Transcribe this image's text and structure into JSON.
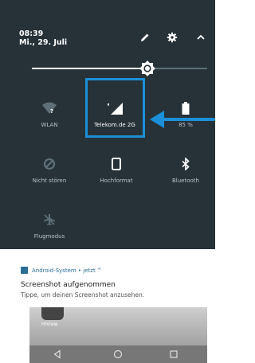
{
  "status": {
    "time": "08:39",
    "date": "Mi., 29. Juli"
  },
  "header_icons": [
    "edit-icon",
    "settings-icon",
    "collapse-icon"
  ],
  "tiles": [
    {
      "name": "wlan",
      "label": "WLAN",
      "icon": "wifi-question-icon",
      "active": false
    },
    {
      "name": "mobile-data",
      "label": "Telekom.de 2G",
      "icon": "cellular-signal-icon",
      "active": true
    },
    {
      "name": "battery",
      "label": "85 %",
      "icon": "battery-icon",
      "active": false
    },
    {
      "name": "do-not-disturb",
      "label": "Nicht stören",
      "icon": "do-not-disturb-icon",
      "active": false
    },
    {
      "name": "orientation",
      "label": "Hochformat",
      "icon": "portrait-icon",
      "active": false
    },
    {
      "name": "bluetooth",
      "label": "Bluetooth",
      "icon": "bluetooth-icon",
      "active": false
    },
    {
      "name": "airplane",
      "label": "Flugmodus",
      "icon": "airplane-icon",
      "active": false
    }
  ],
  "brightness_level": 0.66,
  "notification": {
    "app": "Android-System • jetzt ^",
    "title": "Screenshot aufgenommen",
    "text": "Tippe, um deinen Screenshot anzusehen.",
    "preview_label": "HiView"
  },
  "colors": {
    "panel_bg": "#263238",
    "highlight": "#1b90d9",
    "accent_text": "#2a6e95"
  }
}
